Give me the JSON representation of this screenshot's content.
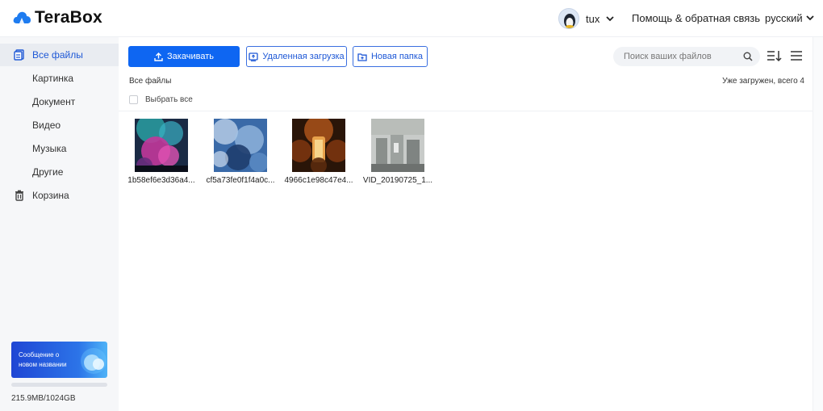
{
  "app": {
    "name": "TeraBox"
  },
  "header": {
    "user_name": "tux",
    "help_label": "Помощь & обратная связь",
    "language": "русский"
  },
  "sidebar": {
    "items": [
      {
        "label": "Все файлы",
        "icon": "files-icon",
        "active": true
      },
      {
        "label": "Картинка"
      },
      {
        "label": "Документ"
      },
      {
        "label": "Видео"
      },
      {
        "label": "Музыка"
      },
      {
        "label": "Другие"
      },
      {
        "label": "Корзина",
        "icon": "trash-icon"
      }
    ],
    "promo_text": "Сообщение о новом названии",
    "storage": {
      "used_text": "215.9MB/1024GB",
      "fraction": 0.0002
    }
  },
  "toolbar": {
    "upload_label": "Закачивать",
    "remote_label": "Удаленная загрузка",
    "new_folder_label": "Новая папка",
    "search_placeholder": "Поиск ваших файлов"
  },
  "main": {
    "breadcrumb": "Все файлы",
    "loaded_text": "Уже загружен, всего 4",
    "select_all_label": "Выбрать все",
    "files": [
      {
        "name": "1b58ef6e3d36a4..."
      },
      {
        "name": "cf5a73fe0f1f4a0c..."
      },
      {
        "name": "4966c1e98c47e4..."
      },
      {
        "name": "VID_20190725_1..."
      }
    ]
  },
  "colors": {
    "accent": "#0e66f2",
    "sidebar_bg": "#f6f7f9",
    "active_text": "#1e58d6"
  }
}
